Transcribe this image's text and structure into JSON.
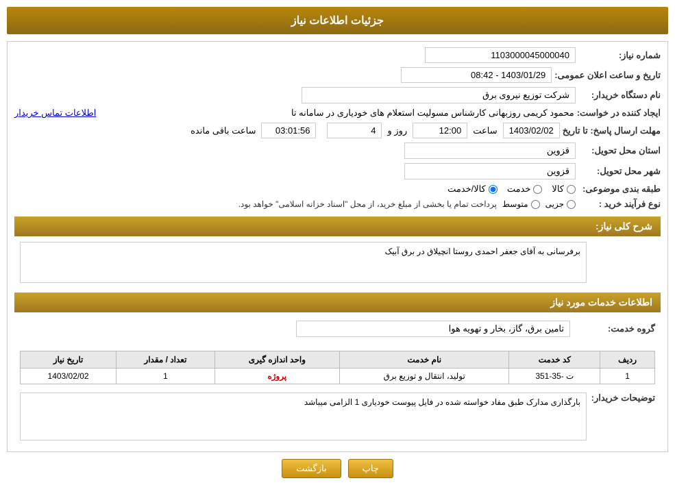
{
  "header": {
    "title": "جزئیات اطلاعات نیاز"
  },
  "labels": {
    "needNumber": "شماره نیاز:",
    "announceDate": "تاریخ و ساعت اعلان عمومی:",
    "buyerName": "نام دستگاه خریدار:",
    "creator": "ایجاد کننده در خواست:",
    "deadline": "مهلت ارسال پاسخ: تا تاریخ",
    "deadlineTime": "ساعت",
    "deadlineDays": "روز و",
    "deadlineAnd": "",
    "deadlineRemainingLabel": "ساعت باقی مانده",
    "province": "استان محل تحویل:",
    "city": "شهر محل تحویل:",
    "category": "طبقه بندی موضوعی:",
    "radioGoods": "کالا",
    "radioService": "خدمت",
    "radioGoodsService": "کالا/خدمت",
    "processType": "نوع فرآیند خرید :",
    "radioPartial": "جزیی",
    "radioMedium": "متوسط",
    "needDescription": "شرح کلی نیاز:",
    "needDescriptionField": "",
    "servicesInfo": "اطلاعات خدمات مورد نیاز",
    "serviceGroup": "گروه خدمت:",
    "buyerNotes": "توضیحات خریدار:"
  },
  "values": {
    "needNumber": "1103000045000040",
    "announceDate": "1403/01/29 - 08:42",
    "buyerName": "شرکت توزیع نیروی برق",
    "creator": "محمود کریمی روزبهانی کارشناس  مسولیت استعلام های خودیاری در سامانه تا",
    "contactLink": "اطلاعات تماس خریدار",
    "deadlineDate": "1403/02/02",
    "deadlineTime": "12:00",
    "deadlineDays": "4",
    "deadlineRemaining": "03:01:56",
    "processDescription": "پرداخت تمام یا بخشی از مبلغ خرید، از محل \"اسناد خزانه اسلامی\" خواهد بود.",
    "province": "قزوین",
    "city": "قزوین",
    "needDescriptionText": "برفرسانی به آقای جعفر احمدی روستا انچیلاق در برق آبیک",
    "serviceGroup": "تامین برق، گاز، بخار و تهویه هوا",
    "buyerNotesText": "بارگذاری مدارک طبق مفاد خواسته شده در فایل پیوست خودیاری 1 الزامی میباشد"
  },
  "table": {
    "headers": {
      "rowNumber": "ردیف",
      "serviceCode": "کد خدمت",
      "serviceName": "نام خدمت",
      "measurementUnit": "واحد اندازه گیری",
      "quantity": "تعداد / مقدار",
      "needDate": "تاریخ نیاز"
    },
    "rows": [
      {
        "rowNumber": "1",
        "serviceCode": "ت -35-351",
        "serviceName": "تولید، انتقال و توزیع برق",
        "measurementUnit": "پروژه",
        "quantity": "1",
        "needDate": "1403/02/02"
      }
    ]
  },
  "buttons": {
    "print": "چاپ",
    "back": "بازگشت"
  }
}
